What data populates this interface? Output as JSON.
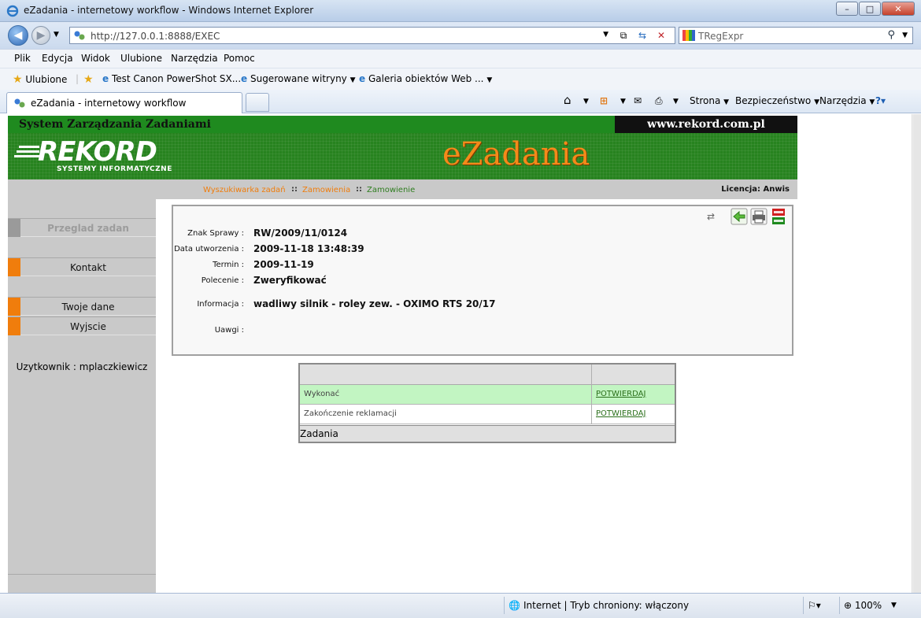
{
  "window": {
    "title": "eZadania - internetowy workflow - Windows Internet Explorer",
    "minimize": "–",
    "maximize": "□",
    "close": "✕"
  },
  "address": {
    "url": "http://127.0.0.1:8888/EXEC",
    "search_placeholder": "TRegExpr"
  },
  "menu": [
    "Plik",
    "Edycja",
    "Widok",
    "Ulubione",
    "Narzędzia",
    "Pomoc"
  ],
  "favorites": {
    "label": "Ulubione",
    "items": [
      "Test Canon PowerShot SX...",
      "Sugerowane witryny",
      "Galeria obiektów Web ..."
    ]
  },
  "tab": {
    "title": "eZadania - internetowy workflow"
  },
  "commands": [
    "Strona",
    "Bezpieczeństwo",
    "Narzędzia"
  ],
  "site": {
    "system_title": "System Zarządzania Zadaniami",
    "url": "www.rekord.com.pl",
    "logo_text": "REKORD",
    "logo_sub": "SYSTEMY INFORMATYCZNE",
    "app_name": "eZadania",
    "breadcrumbs": [
      {
        "label": "Wyszukiwarka zadań",
        "color": "#f07d0c"
      },
      {
        "label": "Zamowienia",
        "color": "#f07d0c"
      },
      {
        "label": "Zamowienie",
        "color": "#2e7d1f"
      }
    ],
    "breadcrumb_sep": "::",
    "license": "Licencja: Anwis"
  },
  "sidebar": {
    "items": [
      {
        "label": "Przeglad zadan",
        "active": false
      },
      {
        "label": "Kontakt",
        "active": true
      },
      {
        "label": "Twoje dane",
        "active": true
      },
      {
        "label": "Wyjscie",
        "active": true
      }
    ],
    "user": "Uzytkownik : mplaczkiewicz"
  },
  "detail": {
    "fields": [
      {
        "key": "Znak Sprawy :",
        "value": "RW/2009/11/0124"
      },
      {
        "key": "Data utworzenia :",
        "value": "2009-11-18 13:48:39"
      },
      {
        "key": "Termin :",
        "value": "2009-11-19"
      },
      {
        "key": "Polecenie :",
        "value": "Zweryfikować"
      },
      {
        "key": "Informacja :",
        "value": "wadliwy silnik - roley zew. - OXIMO RTS 20/17"
      },
      {
        "key": "Uawgi :",
        "value": ""
      }
    ]
  },
  "tasks": {
    "rows": [
      {
        "name": "Wykonać",
        "action": "POTWIERDAJ",
        "bg": "#c2f5c2"
      },
      {
        "name": "Zakończenie reklamacji",
        "action": "POTWIERDAJ",
        "bg": "#ffffff"
      }
    ],
    "footer": "Zadania"
  },
  "status": {
    "zone": "Internet | Tryb chroniony: włączony",
    "zoom": "100%"
  }
}
